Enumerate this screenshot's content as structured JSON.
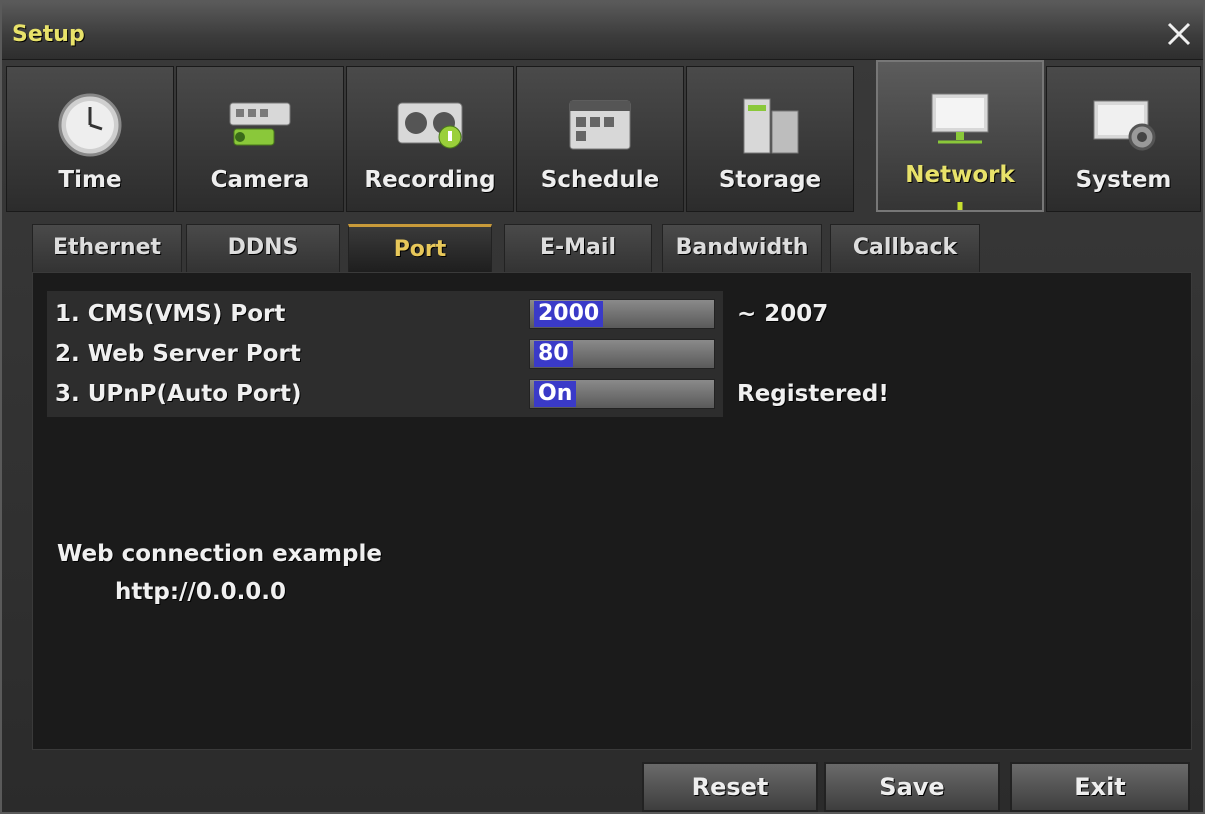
{
  "window": {
    "title": "Setup",
    "close_icon": "close-icon"
  },
  "nav": {
    "items": [
      {
        "label": "Time",
        "icon": "clock-icon"
      },
      {
        "label": "Camera",
        "icon": "camera-icon"
      },
      {
        "label": "Recording",
        "icon": "recording-icon"
      },
      {
        "label": "Schedule",
        "icon": "schedule-icon"
      },
      {
        "label": "Storage",
        "icon": "storage-icon"
      },
      {
        "label": "Network",
        "icon": "network-icon",
        "active": true
      },
      {
        "label": "System",
        "icon": "system-icon"
      }
    ]
  },
  "tabs": [
    {
      "label": "Ethernet"
    },
    {
      "label": "DDNS"
    },
    {
      "label": "Port",
      "active": true
    },
    {
      "label": "E-Mail"
    },
    {
      "label": "Bandwidth"
    },
    {
      "label": "Callback"
    }
  ],
  "settings": [
    {
      "label": "1. CMS(VMS) Port",
      "value": "2000",
      "after": "~ 2007"
    },
    {
      "label": "2. Web Server Port",
      "value": "80",
      "after": ""
    },
    {
      "label": "3. UPnP(Auto Port)",
      "value": "On",
      "after": "Registered!"
    }
  ],
  "example": {
    "title": "Web connection example",
    "url": "http://0.0.0.0"
  },
  "buttons": {
    "reset": "Reset",
    "save": "Save",
    "exit": "Exit"
  },
  "colors": {
    "title": "#e8e26a",
    "active_tab": "#e8c85a",
    "field_highlight": "#3a3ac8"
  }
}
